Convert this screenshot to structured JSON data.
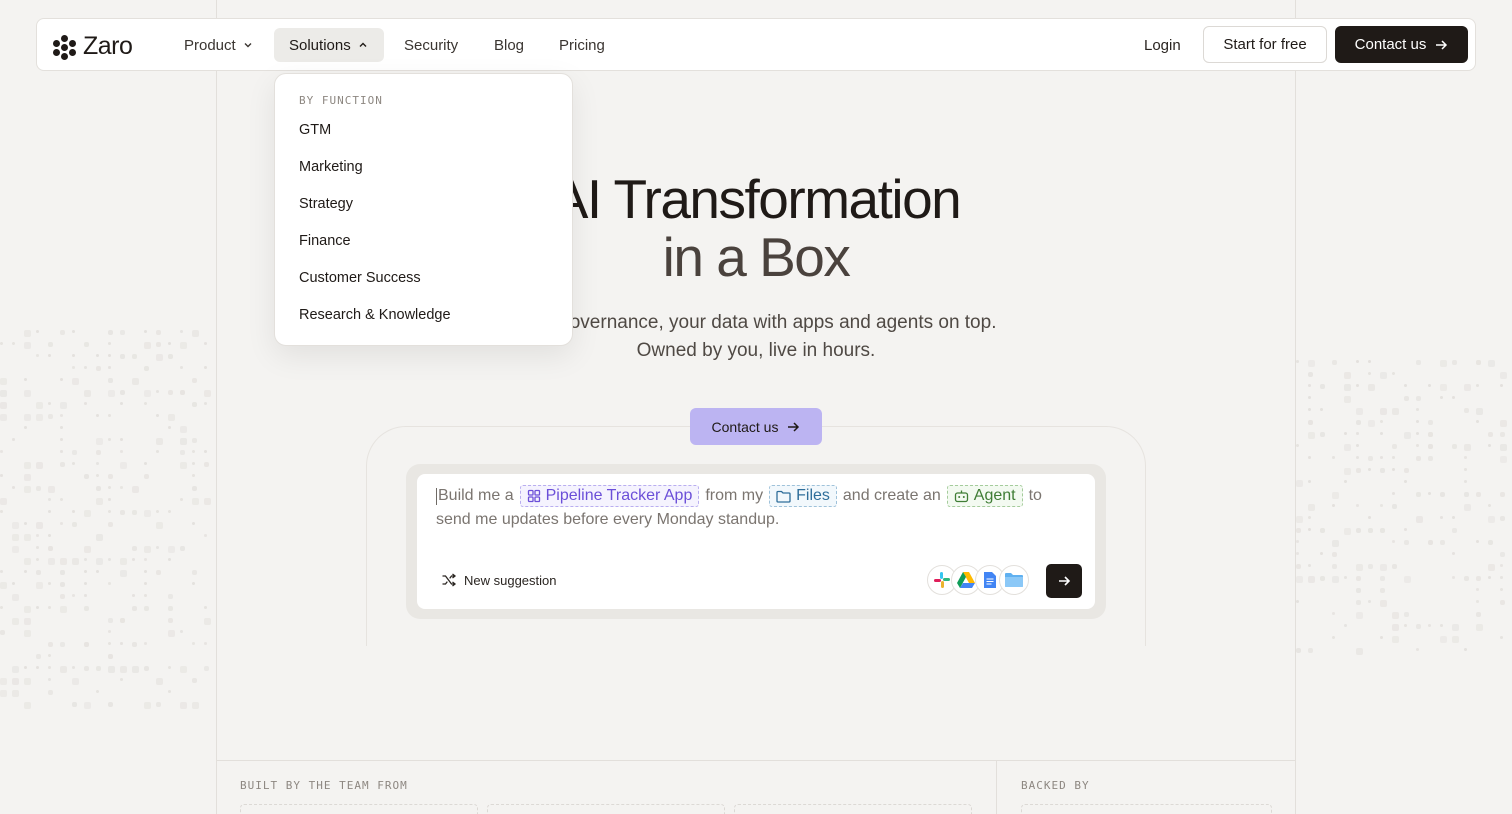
{
  "brand": {
    "name": "Zaro"
  },
  "nav": {
    "items": [
      {
        "label": "Product",
        "has_caret": true,
        "open": false
      },
      {
        "label": "Solutions",
        "has_caret": true,
        "open": true
      },
      {
        "label": "Security"
      },
      {
        "label": "Blog"
      },
      {
        "label": "Pricing"
      }
    ],
    "login_label": "Login",
    "start_label": "Start for free",
    "contact_label": "Contact us"
  },
  "solutions_menu": {
    "heading": "BY FUNCTION",
    "items": [
      "GTM",
      "Marketing",
      "Strategy",
      "Finance",
      "Customer Success",
      "Research & Knowledge"
    ]
  },
  "hero": {
    "title_line1": "AI Transformation",
    "title_line2": "in a Box",
    "subtitle_line1": "Your governance, your data with apps and agents on top.",
    "subtitle_line2": "Owned by you, live in hours.",
    "cta_label": "Contact us"
  },
  "prompt": {
    "text_before_app": "Build me a",
    "app_chip": "Pipeline Tracker App",
    "text_before_files": "from my",
    "files_chip": "Files",
    "text_before_agent": "and create an",
    "agent_chip": "Agent",
    "text_after_agent": "to",
    "line2": "send me updates before every Monday standup.",
    "suggestion_label": "New suggestion",
    "integrations": [
      "slack-icon",
      "google-drive-icon",
      "google-docs-icon",
      "folder-icon"
    ]
  },
  "bottom": {
    "built_by_label": "BUILT BY THE TEAM FROM",
    "backed_by_label": "BACKED BY"
  },
  "colors": {
    "accent": "#bcb4f2",
    "dark": "#1f1a17",
    "background": "#f4f3f1"
  }
}
